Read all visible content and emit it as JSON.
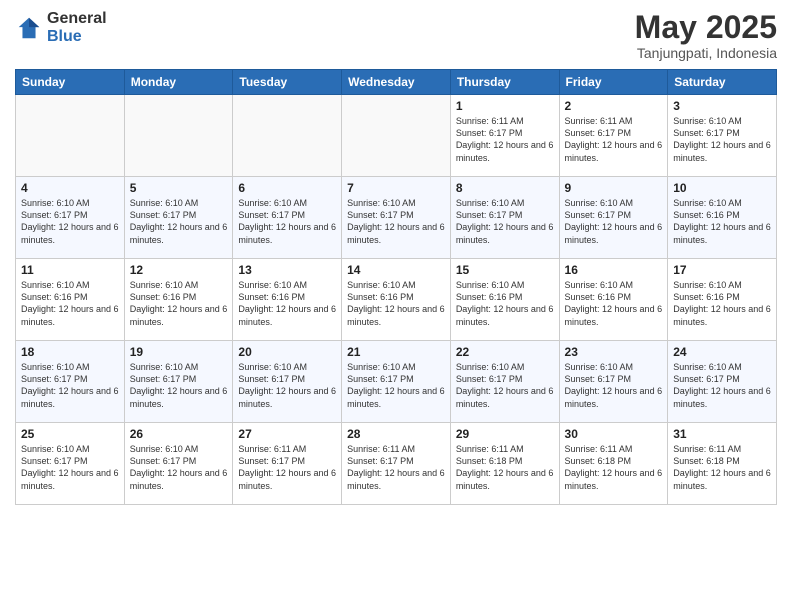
{
  "header": {
    "logo_general": "General",
    "logo_blue": "Blue",
    "title": "May 2025",
    "subtitle": "Tanjungpati, Indonesia"
  },
  "weekdays": [
    "Sunday",
    "Monday",
    "Tuesday",
    "Wednesday",
    "Thursday",
    "Friday",
    "Saturday"
  ],
  "weeks": [
    [
      {
        "day": "",
        "info": ""
      },
      {
        "day": "",
        "info": ""
      },
      {
        "day": "",
        "info": ""
      },
      {
        "day": "",
        "info": ""
      },
      {
        "day": "1",
        "info": "Sunrise: 6:11 AM\nSunset: 6:17 PM\nDaylight: 12 hours and 6 minutes."
      },
      {
        "day": "2",
        "info": "Sunrise: 6:11 AM\nSunset: 6:17 PM\nDaylight: 12 hours and 6 minutes."
      },
      {
        "day": "3",
        "info": "Sunrise: 6:10 AM\nSunset: 6:17 PM\nDaylight: 12 hours and 6 minutes."
      }
    ],
    [
      {
        "day": "4",
        "info": "Sunrise: 6:10 AM\nSunset: 6:17 PM\nDaylight: 12 hours and 6 minutes."
      },
      {
        "day": "5",
        "info": "Sunrise: 6:10 AM\nSunset: 6:17 PM\nDaylight: 12 hours and 6 minutes."
      },
      {
        "day": "6",
        "info": "Sunrise: 6:10 AM\nSunset: 6:17 PM\nDaylight: 12 hours and 6 minutes."
      },
      {
        "day": "7",
        "info": "Sunrise: 6:10 AM\nSunset: 6:17 PM\nDaylight: 12 hours and 6 minutes."
      },
      {
        "day": "8",
        "info": "Sunrise: 6:10 AM\nSunset: 6:17 PM\nDaylight: 12 hours and 6 minutes."
      },
      {
        "day": "9",
        "info": "Sunrise: 6:10 AM\nSunset: 6:17 PM\nDaylight: 12 hours and 6 minutes."
      },
      {
        "day": "10",
        "info": "Sunrise: 6:10 AM\nSunset: 6:16 PM\nDaylight: 12 hours and 6 minutes."
      }
    ],
    [
      {
        "day": "11",
        "info": "Sunrise: 6:10 AM\nSunset: 6:16 PM\nDaylight: 12 hours and 6 minutes."
      },
      {
        "day": "12",
        "info": "Sunrise: 6:10 AM\nSunset: 6:16 PM\nDaylight: 12 hours and 6 minutes."
      },
      {
        "day": "13",
        "info": "Sunrise: 6:10 AM\nSunset: 6:16 PM\nDaylight: 12 hours and 6 minutes."
      },
      {
        "day": "14",
        "info": "Sunrise: 6:10 AM\nSunset: 6:16 PM\nDaylight: 12 hours and 6 minutes."
      },
      {
        "day": "15",
        "info": "Sunrise: 6:10 AM\nSunset: 6:16 PM\nDaylight: 12 hours and 6 minutes."
      },
      {
        "day": "16",
        "info": "Sunrise: 6:10 AM\nSunset: 6:16 PM\nDaylight: 12 hours and 6 minutes."
      },
      {
        "day": "17",
        "info": "Sunrise: 6:10 AM\nSunset: 6:16 PM\nDaylight: 12 hours and 6 minutes."
      }
    ],
    [
      {
        "day": "18",
        "info": "Sunrise: 6:10 AM\nSunset: 6:17 PM\nDaylight: 12 hours and 6 minutes."
      },
      {
        "day": "19",
        "info": "Sunrise: 6:10 AM\nSunset: 6:17 PM\nDaylight: 12 hours and 6 minutes."
      },
      {
        "day": "20",
        "info": "Sunrise: 6:10 AM\nSunset: 6:17 PM\nDaylight: 12 hours and 6 minutes."
      },
      {
        "day": "21",
        "info": "Sunrise: 6:10 AM\nSunset: 6:17 PM\nDaylight: 12 hours and 6 minutes."
      },
      {
        "day": "22",
        "info": "Sunrise: 6:10 AM\nSunset: 6:17 PM\nDaylight: 12 hours and 6 minutes."
      },
      {
        "day": "23",
        "info": "Sunrise: 6:10 AM\nSunset: 6:17 PM\nDaylight: 12 hours and 6 minutes."
      },
      {
        "day": "24",
        "info": "Sunrise: 6:10 AM\nSunset: 6:17 PM\nDaylight: 12 hours and 6 minutes."
      }
    ],
    [
      {
        "day": "25",
        "info": "Sunrise: 6:10 AM\nSunset: 6:17 PM\nDaylight: 12 hours and 6 minutes."
      },
      {
        "day": "26",
        "info": "Sunrise: 6:10 AM\nSunset: 6:17 PM\nDaylight: 12 hours and 6 minutes."
      },
      {
        "day": "27",
        "info": "Sunrise: 6:11 AM\nSunset: 6:17 PM\nDaylight: 12 hours and 6 minutes."
      },
      {
        "day": "28",
        "info": "Sunrise: 6:11 AM\nSunset: 6:17 PM\nDaylight: 12 hours and 6 minutes."
      },
      {
        "day": "29",
        "info": "Sunrise: 6:11 AM\nSunset: 6:18 PM\nDaylight: 12 hours and 6 minutes."
      },
      {
        "day": "30",
        "info": "Sunrise: 6:11 AM\nSunset: 6:18 PM\nDaylight: 12 hours and 6 minutes."
      },
      {
        "day": "31",
        "info": "Sunrise: 6:11 AM\nSunset: 6:18 PM\nDaylight: 12 hours and 6 minutes."
      }
    ]
  ]
}
